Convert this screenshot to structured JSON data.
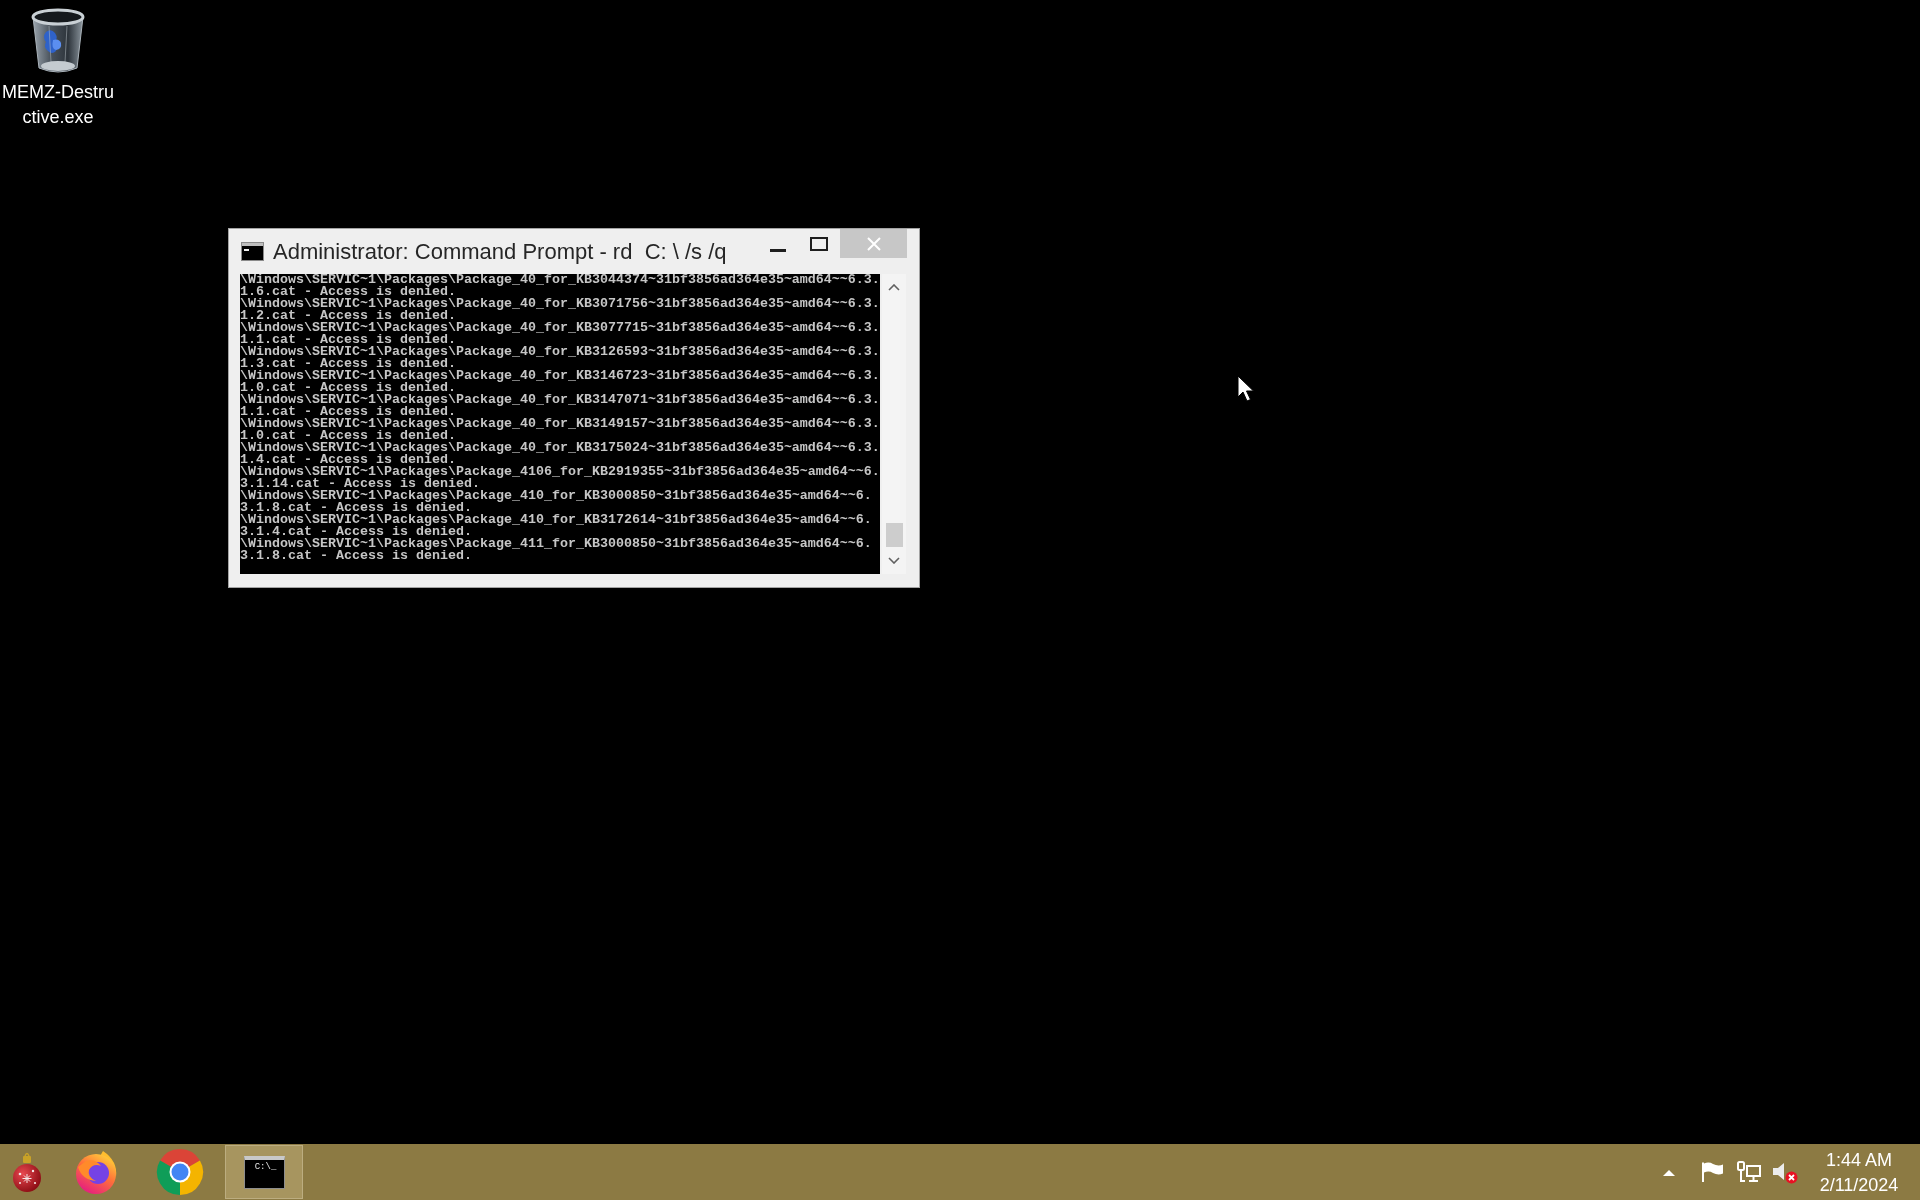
{
  "desktop": {
    "icons": [
      {
        "label": "MEMZ-Destructive.exe"
      }
    ]
  },
  "window": {
    "title": "Administrator: Command Prompt - rd  C: \\ /s /q",
    "console_lines": [
      "\\Windows\\SERVIC~1\\Packages\\Package_40_for_KB3044374~31bf3856ad364e35~amd64~~6.3.1.6.cat - Access is denied.",
      "\\Windows\\SERVIC~1\\Packages\\Package_40_for_KB3071756~31bf3856ad364e35~amd64~~6.3.1.2.cat - Access is denied.",
      "\\Windows\\SERVIC~1\\Packages\\Package_40_for_KB3077715~31bf3856ad364e35~amd64~~6.3.1.1.cat - Access is denied.",
      "\\Windows\\SERVIC~1\\Packages\\Package_40_for_KB3126593~31bf3856ad364e35~amd64~~6.3.1.3.cat - Access is denied.",
      "\\Windows\\SERVIC~1\\Packages\\Package_40_for_KB3146723~31bf3856ad364e35~amd64~~6.3.1.0.cat - Access is denied.",
      "\\Windows\\SERVIC~1\\Packages\\Package_40_for_KB3147071~31bf3856ad364e35~amd64~~6.3.1.1.cat - Access is denied.",
      "\\Windows\\SERVIC~1\\Packages\\Package_40_for_KB3149157~31bf3856ad364e35~amd64~~6.3.1.0.cat - Access is denied.",
      "\\Windows\\SERVIC~1\\Packages\\Package_40_for_KB3175024~31bf3856ad364e35~amd64~~6.3.1.4.cat - Access is denied.",
      "\\Windows\\SERVIC~1\\Packages\\Package_4106_for_KB2919355~31bf3856ad364e35~amd64~~6.3.1.14.cat - Access is denied.",
      "\\Windows\\SERVIC~1\\Packages\\Package_410_for_KB3000850~31bf3856ad364e35~amd64~~6.3.1.8.cat - Access is denied.",
      "\\Windows\\SERVIC~1\\Packages\\Package_410_for_KB3172614~31bf3856ad364e35~amd64~~6.3.1.4.cat - Access is denied.",
      "\\Windows\\SERVIC~1\\Packages\\Package_411_for_KB3000850~31bf3856ad364e35~amd64~~6.3.1.8.cat - Access is denied."
    ]
  },
  "taskbar": {
    "apps": [
      {
        "kind": "ornament",
        "running": false
      },
      {
        "kind": "fox-browser",
        "running": false
      },
      {
        "kind": "ring-browser",
        "running": false
      },
      {
        "kind": "console",
        "running": true,
        "icon_text": "C:\\_"
      }
    ],
    "tray": [
      {
        "kind": "overflow"
      },
      {
        "kind": "flag"
      },
      {
        "kind": "network"
      },
      {
        "kind": "speaker",
        "error": true
      }
    ],
    "clock": {
      "time": "1:44 AM",
      "date": "2/11/2024"
    }
  }
}
